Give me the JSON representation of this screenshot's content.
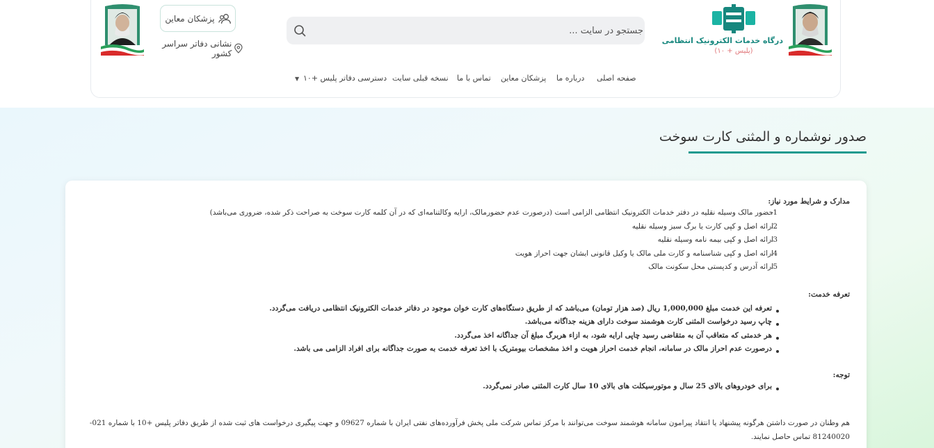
{
  "header": {
    "brand_title": "درگاه خدمات الکترونیک انتظامی",
    "brand_subtitle": "(پلیس + ۱۰)",
    "search_placeholder": "جستجو در سایت ...",
    "doctors_button": "پزشکان معاین",
    "offices_link": "نشانی دفاتر سراسر کشور",
    "nav": [
      {
        "label": "صفحه اصلی"
      },
      {
        "label": "درباره ما"
      },
      {
        "label": "پزشکان معاین"
      },
      {
        "label": "تماس با ما"
      },
      {
        "label": "نسخه قبلی سایت"
      },
      {
        "label": "دسترسی دفاتر پلیس +۱۰"
      }
    ],
    "icons": {
      "search": "search-icon",
      "doctors": "users-icon",
      "location": "location-pin-icon",
      "dropdown": "caret-down-icon"
    },
    "colors": {
      "brand_teal": "#17877e",
      "accent_underline": "#1a9a8f",
      "subtitle_red": "#e0777a"
    }
  },
  "page": {
    "title": "صدور نوشماره و المثنی کارت سوخت",
    "documents_title": "مدارک و شرایط مورد نیاز:",
    "documents": [
      {
        "num": "1.",
        "text": "حضور مالک وسیله نقلیه در دفتر خدمات الکترونیک انتظامی الزامی است (درصورت عدم حضورمالک، ارایه وکالتنامه‌ای که در آن کلمه کارت سوخت به صراحت ذکر شده، ضروری می‌باشد)"
      },
      {
        "num": "2.",
        "text": "ارائه اصل و کپی کارت یا برگ سبز وسیله نقلیه"
      },
      {
        "num": "3.",
        "text": "ارائه اصل و کپی بیمه نامه وسیله نقلیه"
      },
      {
        "num": "4.",
        "text": "ارائه اصل و کپی شناسنامه و کارت ملی مالک یا وکیل قانونی ایشان جهت احراز هویت"
      },
      {
        "num": "5.",
        "text": "ارائه آدرس و کدپستی محل سکونت مالک"
      }
    ],
    "tariff_title": "تعرفه خدمت:",
    "tariff_items": [
      "تعرفه این خدمت مبلغ 1,000,000 ریال (صد هزار تومان) می‌باشد که از طریق دستگاه‌های کارت خوان موجود در دفاتر خدمات الکترونیک انتظامی دریافت می‌گردد.",
      "چاپ رسید درخواست المثنی کارت هوشمند سوخت دارای هزینه جداگانه می‌باشد.",
      "هر خدمتی که متعاقب آن به متقاضی رسید چاپی ارایه شود، به ازاء هربرگ مبلغ آن جداگانه اخذ می‌گردد.",
      "درصورت عدم احراز مالک در سامانه، انجام خدمت احراز هویت و اخذ مشخصات بیومتریک با اخذ تعرفه خدمت به صورت جداگانه برای افراد الزامی می باشد."
    ],
    "note_title": "توجه:",
    "note_items": [
      "برای خودروهای بالای 25 سال و موتورسیکلت های بالای 10 سال کارت المثنی صادر نمی‌گردد."
    ],
    "contact_text": "هم وطنان در صورت داشتن هرگونه پیشنهاد یا انتقاد پیرامون سامانه هوشمند سوخت می‌توانند با مرکز تماس شرکت ملی پخش فرآورده‌های نفتی ایران با شماره 09627 و جهت پیگیری درخواست های ثبت شده از طریق دفاتر پلیس +10 با شماره 021-81240020 تماس حاصل نمایند."
  }
}
